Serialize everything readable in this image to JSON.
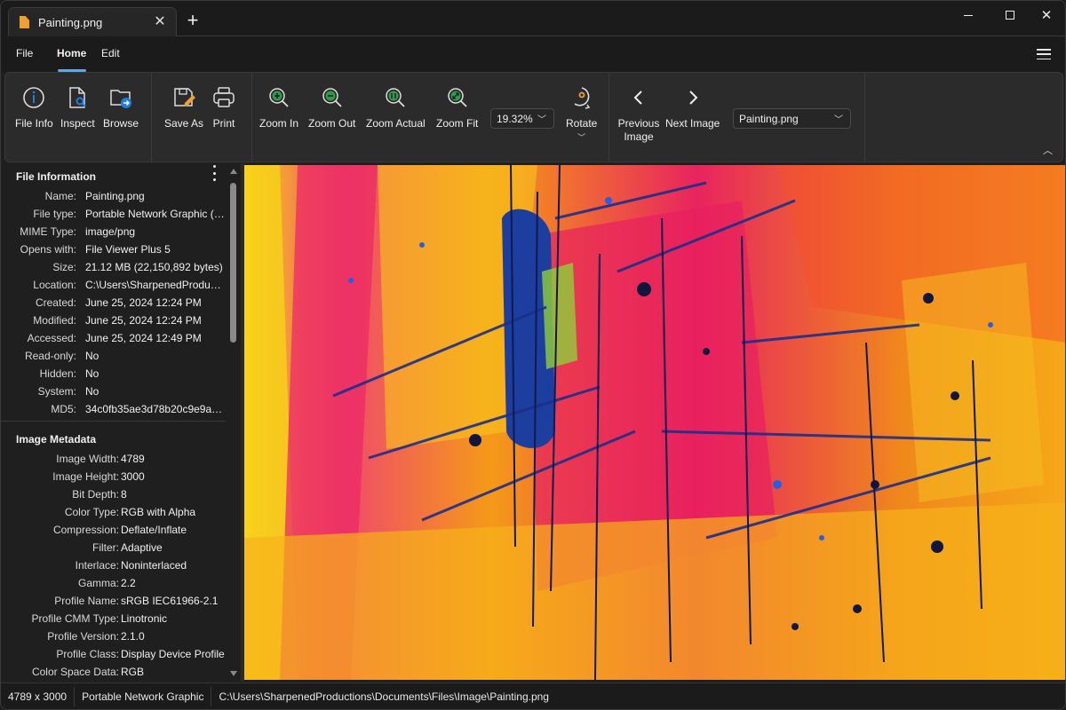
{
  "window": {
    "tab_title": "Painting.png",
    "new_tab_icon": "plus-icon",
    "controls": [
      "minimize",
      "maximize",
      "close"
    ]
  },
  "menu": {
    "items": [
      "File",
      "Home",
      "Edit"
    ],
    "active": "Home"
  },
  "ribbon": {
    "file_info": "File Info",
    "inspect": "Inspect",
    "browse": "Browse",
    "save_as": "Save As",
    "print": "Print",
    "zoom_in": "Zoom In",
    "zoom_out": "Zoom Out",
    "zoom_actual": "Zoom Actual",
    "zoom_fit": "Zoom Fit",
    "zoom_level": "19.32%",
    "rotate": "Rotate",
    "previous_image": "Previous Image",
    "next_image": "Next Image",
    "file_select": "Painting.png"
  },
  "colors": {
    "accent": "#60a8e8",
    "icon_blue": "#1e7ee0",
    "icon_green": "#2e9a4e",
    "icon_orange": "#f0a030"
  },
  "file_information": {
    "title": "File Information",
    "rows": [
      {
        "key": "Name:",
        "value": "Painting.png"
      },
      {
        "key": "File type:",
        "value": "Portable Network Graphic (...."
      },
      {
        "key": "MIME Type:",
        "value": "image/png"
      },
      {
        "key": "Opens with:",
        "value": "File Viewer Plus 5"
      },
      {
        "key": "Size:",
        "value": "21.12 MB (22,150,892 bytes)"
      },
      {
        "key": "Location:",
        "value": "C:\\Users\\SharpenedProduct..."
      },
      {
        "key": "Created:",
        "value": "June 25, 2024 12:24 PM"
      },
      {
        "key": "Modified:",
        "value": "June 25, 2024 12:24 PM"
      },
      {
        "key": "Accessed:",
        "value": "June 25, 2024 12:49 PM"
      },
      {
        "key": "Read-only:",
        "value": "No"
      },
      {
        "key": "Hidden:",
        "value": "No"
      },
      {
        "key": "System:",
        "value": "No"
      },
      {
        "key": "MD5:",
        "value": "34c0fb35ae3d78b20c9e9a1c..."
      }
    ]
  },
  "image_metadata": {
    "title": "Image Metadata",
    "rows": [
      {
        "key": "Image Width:",
        "value": "4789"
      },
      {
        "key": "Image Height:",
        "value": "3000"
      },
      {
        "key": "Bit Depth:",
        "value": "8"
      },
      {
        "key": "Color Type:",
        "value": "RGB with Alpha"
      },
      {
        "key": "Compression:",
        "value": "Deflate/Inflate"
      },
      {
        "key": "Filter:",
        "value": "Adaptive"
      },
      {
        "key": "Interlace:",
        "value": "Noninterlaced"
      },
      {
        "key": "Gamma:",
        "value": "2.2"
      },
      {
        "key": "Profile Name:",
        "value": "sRGB IEC61966-2.1"
      },
      {
        "key": "Profile CMM Type:",
        "value": "Linotronic"
      },
      {
        "key": "Profile Version:",
        "value": "2.1.0"
      },
      {
        "key": "Profile Class:",
        "value": "Display Device Profile"
      },
      {
        "key": "Color Space Data:",
        "value": "RGB"
      }
    ]
  },
  "statusbar": {
    "dimensions": "4789 x 3000",
    "file_type": "Portable Network Graphic",
    "path": "C:\\Users\\SharpenedProductions\\Documents\\Files\\Image\\Painting.png"
  },
  "image": {
    "description": "abstract acrylic painting in pink, orange, yellow with dark blue strokes"
  }
}
